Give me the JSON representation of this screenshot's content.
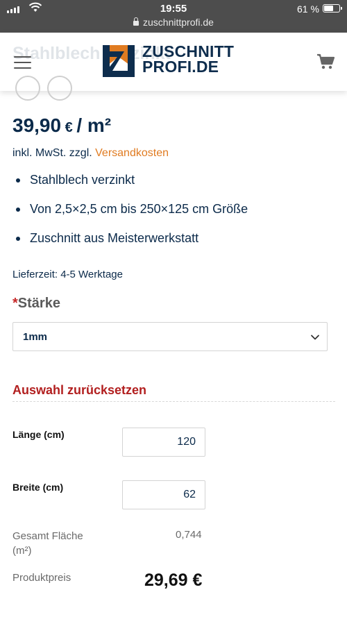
{
  "status_bar": {
    "time": "19:55",
    "url": "zuschnittprofi.de",
    "battery": "61 %"
  },
  "header": {
    "brand_line1": "ZUSCHNITT",
    "brand_line2": "PROFI.DE",
    "ghost_title": "Stahlblech verzinkt"
  },
  "product": {
    "price_value": "39,90",
    "price_unit": "€ / m²",
    "tax_text": "inkl. MwSt. zzgl. ",
    "shipping_link": "Versandkosten",
    "features": [
      "Stahlblech verzinkt",
      "Von 2,5×2,5 cm bis 250×125 cm Größe",
      "Zuschnitt aus Meisterwerkstatt"
    ],
    "delivery": "Lieferzeit: 4-5 Werktage"
  },
  "variation": {
    "required_mark": "*",
    "label": "Stärke",
    "selected": "1mm",
    "reset_label": "Auswahl zurücksetzen"
  },
  "calculator": {
    "length_label": "Länge (cm)",
    "length_value": "120",
    "width_label": "Breite (cm)",
    "width_value": "62",
    "area_label_line1": "Gesamt Fläche",
    "area_label_line2": "(m²)",
    "area_value": "0,744",
    "price_label": "Produktpreis",
    "price_value": "29,69 €"
  },
  "colors": {
    "accent_orange": "#e07b21",
    "reset_red": "#b21f1f",
    "text_navy": "#0b2a4a"
  }
}
